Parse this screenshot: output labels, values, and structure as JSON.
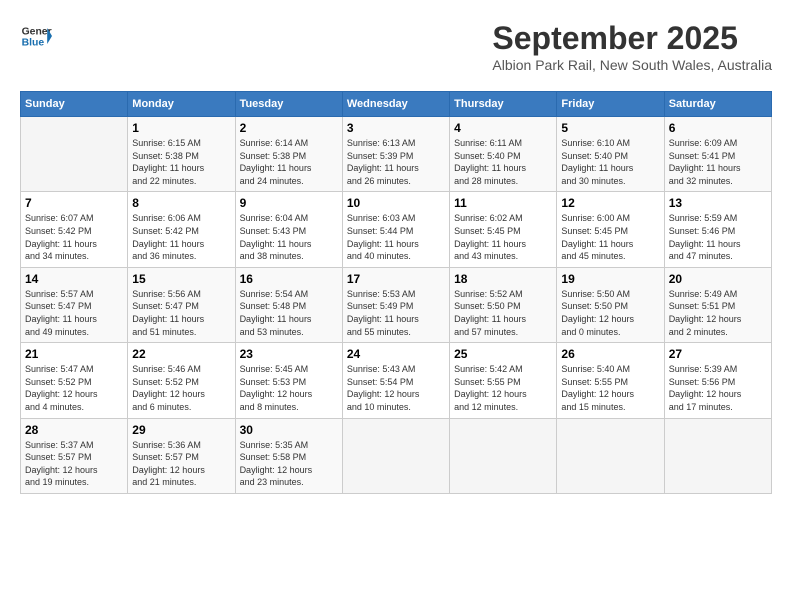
{
  "header": {
    "logo_line1": "General",
    "logo_line2": "Blue",
    "month": "September 2025",
    "location": "Albion Park Rail, New South Wales, Australia"
  },
  "days_of_week": [
    "Sunday",
    "Monday",
    "Tuesday",
    "Wednesday",
    "Thursday",
    "Friday",
    "Saturday"
  ],
  "weeks": [
    [
      {
        "day": "",
        "detail": ""
      },
      {
        "day": "1",
        "detail": "Sunrise: 6:15 AM\nSunset: 5:38 PM\nDaylight: 11 hours\nand 22 minutes."
      },
      {
        "day": "2",
        "detail": "Sunrise: 6:14 AM\nSunset: 5:38 PM\nDaylight: 11 hours\nand 24 minutes."
      },
      {
        "day": "3",
        "detail": "Sunrise: 6:13 AM\nSunset: 5:39 PM\nDaylight: 11 hours\nand 26 minutes."
      },
      {
        "day": "4",
        "detail": "Sunrise: 6:11 AM\nSunset: 5:40 PM\nDaylight: 11 hours\nand 28 minutes."
      },
      {
        "day": "5",
        "detail": "Sunrise: 6:10 AM\nSunset: 5:40 PM\nDaylight: 11 hours\nand 30 minutes."
      },
      {
        "day": "6",
        "detail": "Sunrise: 6:09 AM\nSunset: 5:41 PM\nDaylight: 11 hours\nand 32 minutes."
      }
    ],
    [
      {
        "day": "7",
        "detail": "Sunrise: 6:07 AM\nSunset: 5:42 PM\nDaylight: 11 hours\nand 34 minutes."
      },
      {
        "day": "8",
        "detail": "Sunrise: 6:06 AM\nSunset: 5:42 PM\nDaylight: 11 hours\nand 36 minutes."
      },
      {
        "day": "9",
        "detail": "Sunrise: 6:04 AM\nSunset: 5:43 PM\nDaylight: 11 hours\nand 38 minutes."
      },
      {
        "day": "10",
        "detail": "Sunrise: 6:03 AM\nSunset: 5:44 PM\nDaylight: 11 hours\nand 40 minutes."
      },
      {
        "day": "11",
        "detail": "Sunrise: 6:02 AM\nSunset: 5:45 PM\nDaylight: 11 hours\nand 43 minutes."
      },
      {
        "day": "12",
        "detail": "Sunrise: 6:00 AM\nSunset: 5:45 PM\nDaylight: 11 hours\nand 45 minutes."
      },
      {
        "day": "13",
        "detail": "Sunrise: 5:59 AM\nSunset: 5:46 PM\nDaylight: 11 hours\nand 47 minutes."
      }
    ],
    [
      {
        "day": "14",
        "detail": "Sunrise: 5:57 AM\nSunset: 5:47 PM\nDaylight: 11 hours\nand 49 minutes."
      },
      {
        "day": "15",
        "detail": "Sunrise: 5:56 AM\nSunset: 5:47 PM\nDaylight: 11 hours\nand 51 minutes."
      },
      {
        "day": "16",
        "detail": "Sunrise: 5:54 AM\nSunset: 5:48 PM\nDaylight: 11 hours\nand 53 minutes."
      },
      {
        "day": "17",
        "detail": "Sunrise: 5:53 AM\nSunset: 5:49 PM\nDaylight: 11 hours\nand 55 minutes."
      },
      {
        "day": "18",
        "detail": "Sunrise: 5:52 AM\nSunset: 5:50 PM\nDaylight: 11 hours\nand 57 minutes."
      },
      {
        "day": "19",
        "detail": "Sunrise: 5:50 AM\nSunset: 5:50 PM\nDaylight: 12 hours\nand 0 minutes."
      },
      {
        "day": "20",
        "detail": "Sunrise: 5:49 AM\nSunset: 5:51 PM\nDaylight: 12 hours\nand 2 minutes."
      }
    ],
    [
      {
        "day": "21",
        "detail": "Sunrise: 5:47 AM\nSunset: 5:52 PM\nDaylight: 12 hours\nand 4 minutes."
      },
      {
        "day": "22",
        "detail": "Sunrise: 5:46 AM\nSunset: 5:52 PM\nDaylight: 12 hours\nand 6 minutes."
      },
      {
        "day": "23",
        "detail": "Sunrise: 5:45 AM\nSunset: 5:53 PM\nDaylight: 12 hours\nand 8 minutes."
      },
      {
        "day": "24",
        "detail": "Sunrise: 5:43 AM\nSunset: 5:54 PM\nDaylight: 12 hours\nand 10 minutes."
      },
      {
        "day": "25",
        "detail": "Sunrise: 5:42 AM\nSunset: 5:55 PM\nDaylight: 12 hours\nand 12 minutes."
      },
      {
        "day": "26",
        "detail": "Sunrise: 5:40 AM\nSunset: 5:55 PM\nDaylight: 12 hours\nand 15 minutes."
      },
      {
        "day": "27",
        "detail": "Sunrise: 5:39 AM\nSunset: 5:56 PM\nDaylight: 12 hours\nand 17 minutes."
      }
    ],
    [
      {
        "day": "28",
        "detail": "Sunrise: 5:37 AM\nSunset: 5:57 PM\nDaylight: 12 hours\nand 19 minutes."
      },
      {
        "day": "29",
        "detail": "Sunrise: 5:36 AM\nSunset: 5:57 PM\nDaylight: 12 hours\nand 21 minutes."
      },
      {
        "day": "30",
        "detail": "Sunrise: 5:35 AM\nSunset: 5:58 PM\nDaylight: 12 hours\nand 23 minutes."
      },
      {
        "day": "",
        "detail": ""
      },
      {
        "day": "",
        "detail": ""
      },
      {
        "day": "",
        "detail": ""
      },
      {
        "day": "",
        "detail": ""
      }
    ]
  ]
}
